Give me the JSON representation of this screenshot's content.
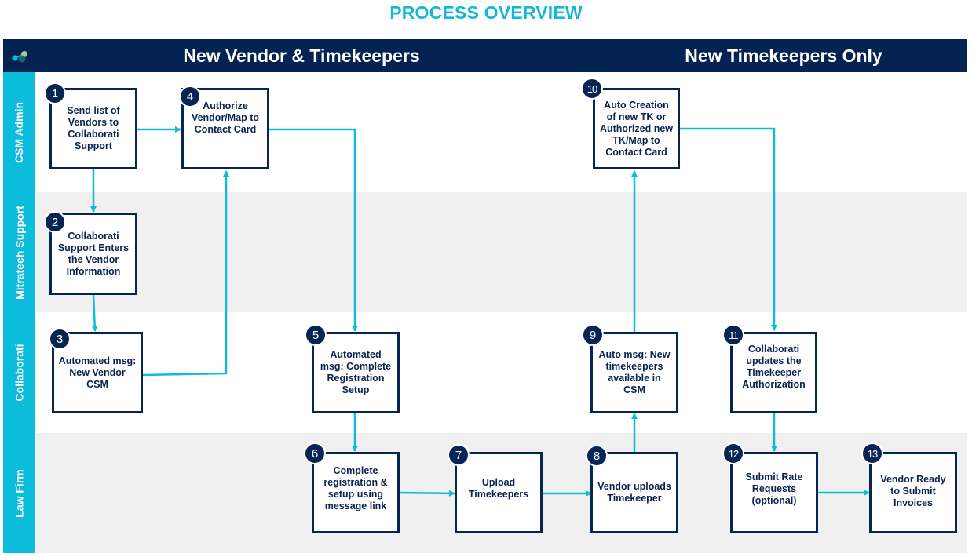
{
  "title": "PROCESS OVERVIEW",
  "header": {
    "logo_icon": "mitratech-logo-icon",
    "sections": [
      "New Vendor & Timekeepers",
      "New Timekeepers Only"
    ]
  },
  "lanes": [
    {
      "label": "CSM Admin"
    },
    {
      "label": "Mitratech Support"
    },
    {
      "label": "Collaborati"
    },
    {
      "label": "Law Firm"
    }
  ],
  "steps": [
    {
      "number": "1",
      "text": "Send list of Vendors to Collaborati Support",
      "lane": "CSM Admin"
    },
    {
      "number": "2",
      "text": "Collaborati Support Enters the Vendor Information",
      "lane": "Mitratech Support"
    },
    {
      "number": "3",
      "text": "Automated msg: New Vendor CSM",
      "lane": "Collaborati"
    },
    {
      "number": "4",
      "text": "Authorize Vendor/Map to Contact Card",
      "lane": "CSM Admin"
    },
    {
      "number": "5",
      "text": "Automated msg: Complete Registration Setup",
      "lane": "Collaborati"
    },
    {
      "number": "6",
      "text": "Complete registration & setup using message link",
      "lane": "Law Firm"
    },
    {
      "number": "7",
      "text": "Upload Timekeepers",
      "lane": "Law Firm"
    },
    {
      "number": "8",
      "text": "Vendor uploads Timekeeper",
      "lane": "Law Firm"
    },
    {
      "number": "9",
      "text": "Auto msg: New timekeepers available in CSM",
      "lane": "Collaborati"
    },
    {
      "number": "10",
      "text": "Auto Creation of new TK or Authorized new TK/Map to Contact Card",
      "lane": "CSM Admin"
    },
    {
      "number": "11",
      "text": "Collaborati updates the Timekeeper Authorization",
      "lane": "Collaborati"
    },
    {
      "number": "12",
      "text": "Submit Rate Requests (optional)",
      "lane": "Law Firm"
    },
    {
      "number": "13",
      "text": "Vendor Ready to Submit Invoices",
      "lane": "Law Firm"
    }
  ],
  "connections": [
    {
      "from": "1",
      "to": "2"
    },
    {
      "from": "1",
      "to": "4"
    },
    {
      "from": "2",
      "to": "3"
    },
    {
      "from": "3",
      "to": "4"
    },
    {
      "from": "4",
      "to": "5"
    },
    {
      "from": "5",
      "to": "6"
    },
    {
      "from": "6",
      "to": "7"
    },
    {
      "from": "7",
      "to": "8"
    },
    {
      "from": "8",
      "to": "9"
    },
    {
      "from": "9",
      "to": "10"
    },
    {
      "from": "10",
      "to": "11"
    },
    {
      "from": "11",
      "to": "12"
    },
    {
      "from": "12",
      "to": "13"
    }
  ],
  "colors": {
    "navy": "#042352",
    "cyan": "#0bbcdb",
    "title": "#14b8d6",
    "lane_grey": "#f0f0f0"
  }
}
